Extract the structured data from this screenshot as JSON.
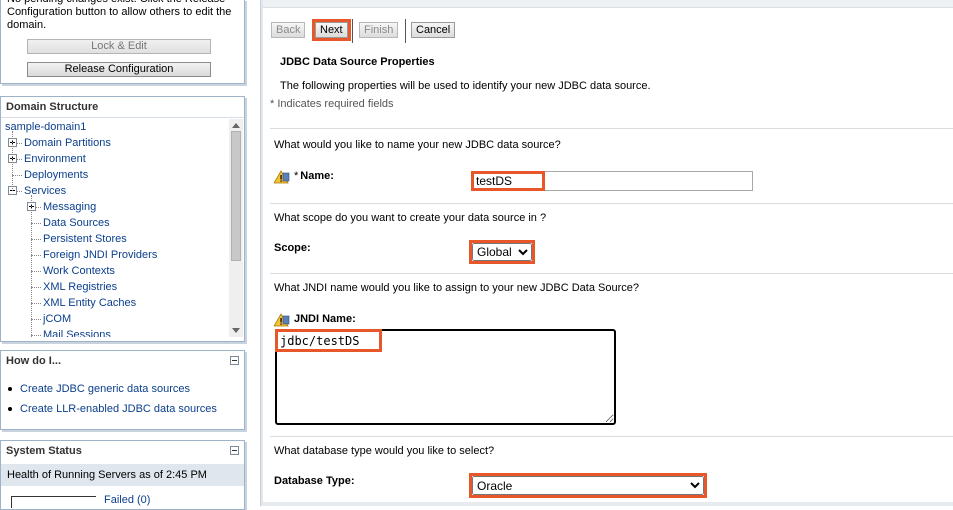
{
  "change_center": {
    "message": "No pending changes exist. Click the Release Configuration button to allow others to edit the domain.",
    "lock_edit_label": "Lock & Edit",
    "release_config_label": "Release Configuration"
  },
  "domain_structure": {
    "title": "Domain Structure",
    "items": [
      {
        "label": "sample-domain1",
        "level": 0,
        "expander": "none"
      },
      {
        "label": "Domain Partitions",
        "level": 1,
        "expander": "plus"
      },
      {
        "label": "Environment",
        "level": 1,
        "expander": "plus"
      },
      {
        "label": "Deployments",
        "level": 1,
        "expander": "none"
      },
      {
        "label": "Services",
        "level": 1,
        "expander": "minus"
      },
      {
        "label": "Messaging",
        "level": 2,
        "expander": "plus"
      },
      {
        "label": "Data Sources",
        "level": 2,
        "expander": "none"
      },
      {
        "label": "Persistent Stores",
        "level": 2,
        "expander": "none"
      },
      {
        "label": "Foreign JNDI Providers",
        "level": 2,
        "expander": "none"
      },
      {
        "label": "Work Contexts",
        "level": 2,
        "expander": "none"
      },
      {
        "label": "XML Registries",
        "level": 2,
        "expander": "none"
      },
      {
        "label": "XML Entity Caches",
        "level": 2,
        "expander": "none"
      },
      {
        "label": "jCOM",
        "level": 2,
        "expander": "none"
      },
      {
        "label": "Mail Sessions",
        "level": 2,
        "expander": "none"
      }
    ]
  },
  "how_do_i": {
    "title": "How do I...",
    "links": [
      "Create JDBC generic data sources",
      "Create LLR-enabled JDBC data sources"
    ]
  },
  "system_status": {
    "title": "System Status",
    "health_text": "Health of Running Servers as of  2:45 PM",
    "failed_label": "Failed (0)"
  },
  "toolbar": {
    "back_label": "Back",
    "next_label": "Next",
    "finish_label": "Finish",
    "cancel_label": "Cancel"
  },
  "form": {
    "section_title": "JDBC Data Source Properties",
    "description": "The following properties will be used to identify your new JDBC data source.",
    "required_note": "* Indicates required fields",
    "name_question": "What would you like to name your new JDBC data source?",
    "name_required_mark": "*",
    "name_label": "Name:",
    "name_value": "testDS",
    "scope_question": "What scope do you want to create your data source in ?",
    "scope_label": "Scope:",
    "scope_value": "Global",
    "jndi_question": "What JNDI name would you like to assign to your new JDBC Data Source?",
    "jndi_label": "JNDI Name:",
    "jndi_value": "jdbc/testDS",
    "dbtype_question": "What database type would you like to select?",
    "dbtype_label": "Database Type:",
    "dbtype_value": "Oracle"
  },
  "colors": {
    "highlight": "#e8572a",
    "link": "#0b3f8c",
    "panel_border": "#9fb3c8"
  }
}
